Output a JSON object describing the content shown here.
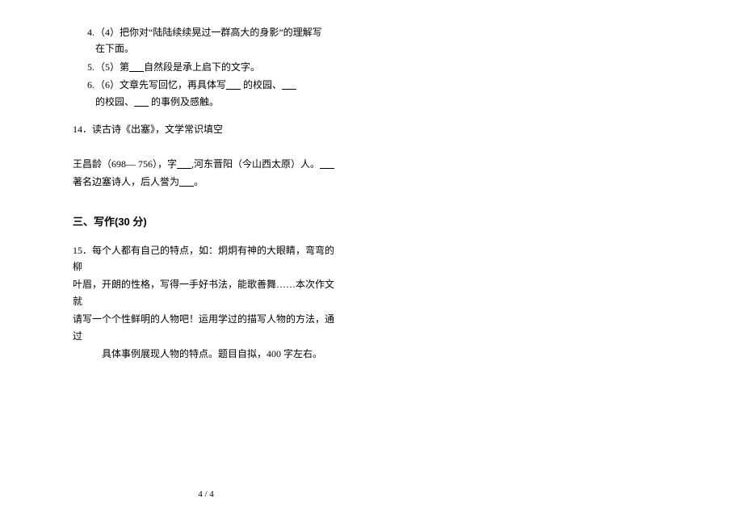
{
  "list": {
    "items": [
      {
        "num": "4.",
        "text1": "（4）把你对“陆陆续续晃过一群高大的身影”的理解写",
        "text2": "在下面。"
      },
      {
        "num": "5.",
        "text1": "（5）第",
        "blank1": "      ",
        "text2": "自然段是承上启下的文字。"
      },
      {
        "num": "6.",
        "text1": "（6）文章先写回忆，再具体写",
        "blank1": "      ",
        "text2": " 的校园、",
        "blank2": "      ",
        "text3": "的校园、",
        "blank3": "      ",
        "text4": " 的事例及感触。"
      }
    ]
  },
  "q14": {
    "line1": "14．读古诗《出塞》，文学常识填空",
    "line2_a": "王昌龄（698— 756），字",
    "blank1": "      ",
    "line2_b": ",河东晋阳（今山西太原）人。",
    "blank2": "      ",
    "line3_a": "著名边塞诗人，后人誉为",
    "blank3": "      ",
    "line3_b": "。"
  },
  "section3": {
    "heading": "三、写作(30 分)",
    "q15": {
      "l1": "15．每个人都有自己的特点，如：炯炯有神的大眼睛，弯弯的柳",
      "l2": "叶眉，开朗的性格，写得一手好书法，能歌善舞……本次作文就",
      "l3": "请写一个个性鲜明的人物吧！运用学过的描写人物的方法，通过",
      "l4": "具体事例展现人物的特点。题目自拟，400 字左右。"
    }
  },
  "pageNum": "4 / 4"
}
